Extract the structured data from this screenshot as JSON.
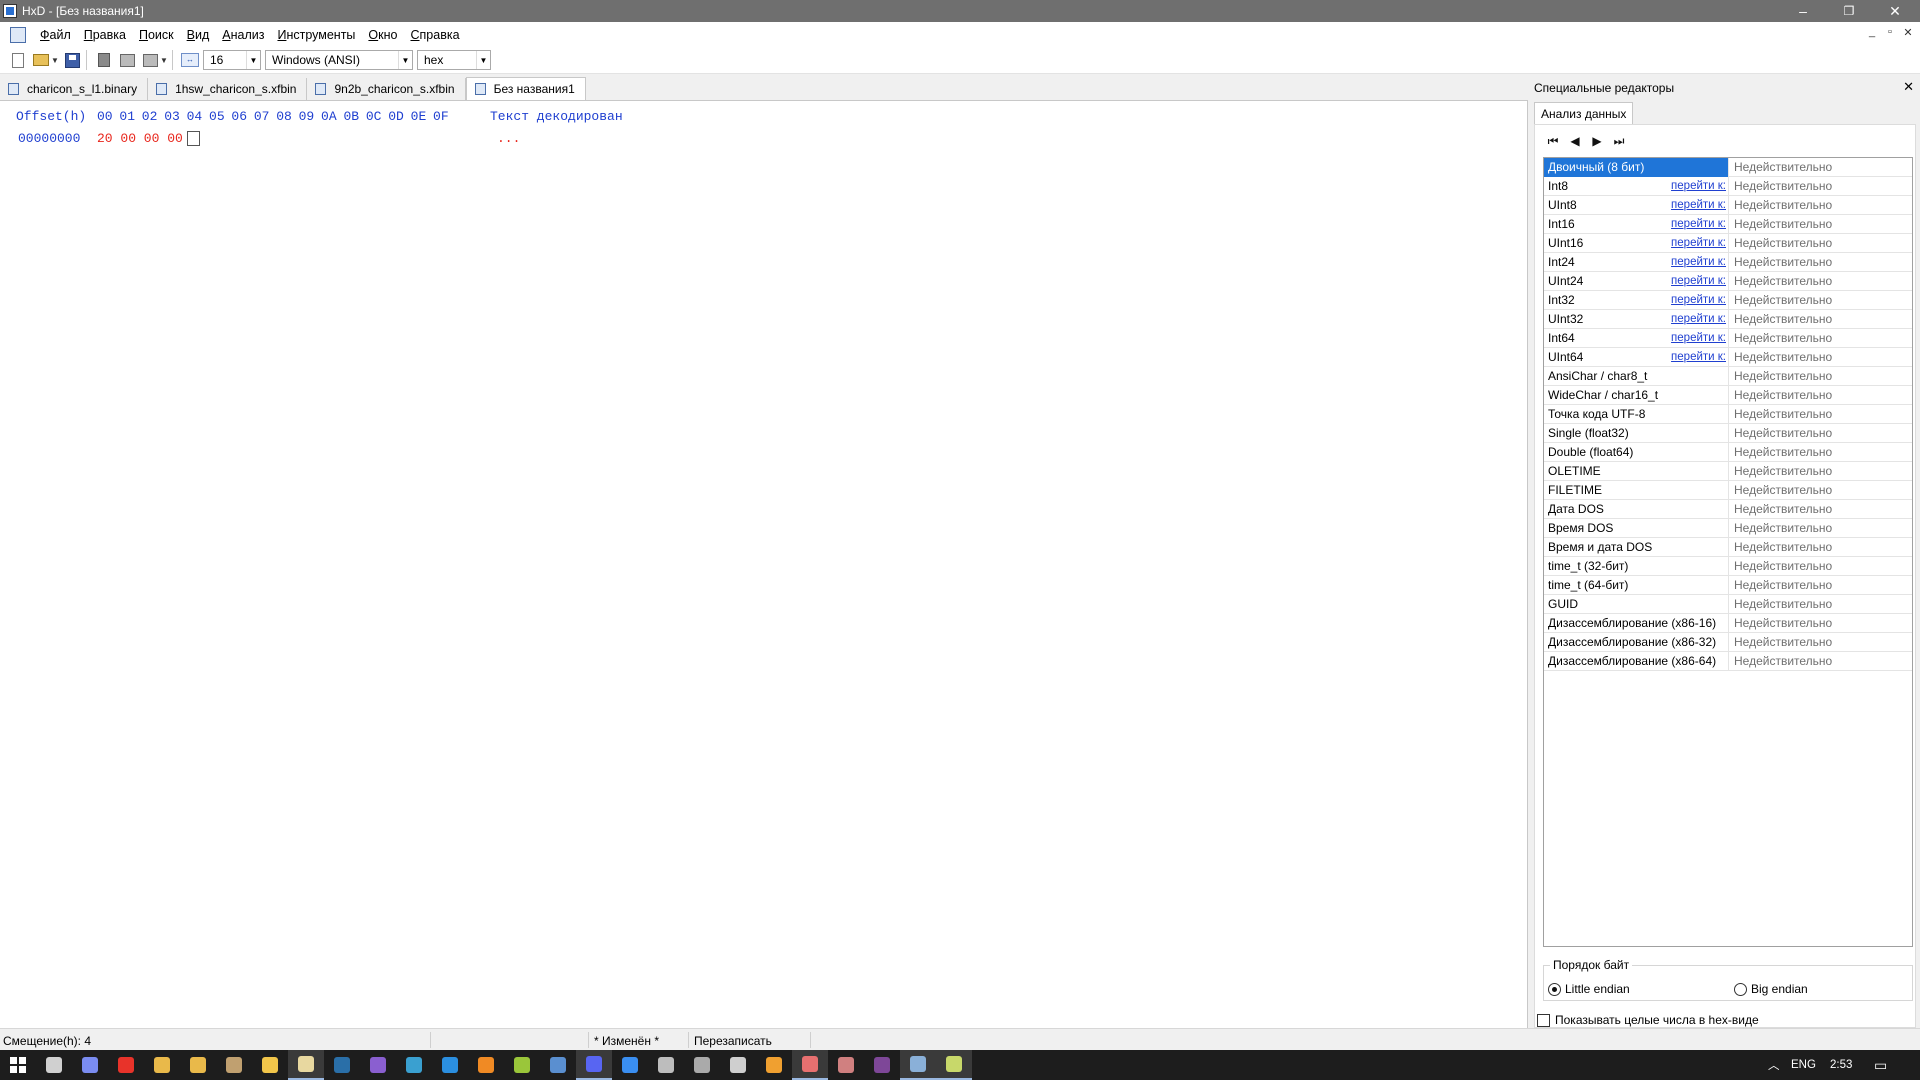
{
  "window": {
    "title": "HxD - [Без названия1]",
    "controls": {
      "minimize": "–",
      "maximize": "❐",
      "close": "✕"
    }
  },
  "menu": [
    "Файл",
    "Правка",
    "Поиск",
    "Вид",
    "Анализ",
    "Инструменты",
    "Окно",
    "Справка"
  ],
  "mdi_controls": {
    "minimize": "_",
    "restore": "▫",
    "close": "✕"
  },
  "toolbar": {
    "bytes_per_row": "16",
    "charset": "Windows (ANSI)",
    "offset_base": "hex"
  },
  "file_tabs": [
    {
      "label": "charicon_s_l1.binary",
      "active": false
    },
    {
      "label": "1hsw_charicon_s.xfbin",
      "active": false
    },
    {
      "label": "9n2b_charicon_s.xfbin",
      "active": false
    },
    {
      "label": "Без названия1",
      "active": true
    }
  ],
  "hex_view": {
    "offset_header": "Offset(h)",
    "column_headers": "00 01 02 03 04 05 06 07 08 09 0A 0B 0C 0D 0E 0F",
    "text_header": "Текст декодирован",
    "rows": [
      {
        "offset": "00000000",
        "bytes": "20 00 00 00",
        "text": "..."
      }
    ]
  },
  "side_panel": {
    "title": "Специальные редакторы",
    "close": "✕",
    "tab": "Анализ данных",
    "nav": {
      "first": "⏮",
      "prev": "◀",
      "next": "▶",
      "last": "⏭"
    },
    "goto_label": "перейти к:",
    "rows": [
      {
        "name": "Двоичный (8 бит)",
        "value": "Недействительно",
        "link": false,
        "selected": true
      },
      {
        "name": "Int8",
        "value": "Недействительно",
        "link": true
      },
      {
        "name": "UInt8",
        "value": "Недействительно",
        "link": true
      },
      {
        "name": "Int16",
        "value": "Недействительно",
        "link": true
      },
      {
        "name": "UInt16",
        "value": "Недействительно",
        "link": true
      },
      {
        "name": "Int24",
        "value": "Недействительно",
        "link": true
      },
      {
        "name": "UInt24",
        "value": "Недействительно",
        "link": true
      },
      {
        "name": "Int32",
        "value": "Недействительно",
        "link": true
      },
      {
        "name": "UInt32",
        "value": "Недействительно",
        "link": true
      },
      {
        "name": "Int64",
        "value": "Недействительно",
        "link": true
      },
      {
        "name": "UInt64",
        "value": "Недействительно",
        "link": true
      },
      {
        "name": "AnsiChar / char8_t",
        "value": "Недействительно",
        "link": false
      },
      {
        "name": "WideChar / char16_t",
        "value": "Недействительно",
        "link": false
      },
      {
        "name": "Точка кода UTF-8",
        "value": "Недействительно",
        "link": false
      },
      {
        "name": "Single (float32)",
        "value": "Недействительно",
        "link": false
      },
      {
        "name": "Double (float64)",
        "value": "Недействительно",
        "link": false
      },
      {
        "name": "OLETIME",
        "value": "Недействительно",
        "link": false
      },
      {
        "name": "FILETIME",
        "value": "Недействительно",
        "link": false
      },
      {
        "name": "Дата DOS",
        "value": "Недействительно",
        "link": false
      },
      {
        "name": "Время DOS",
        "value": "Недействительно",
        "link": false
      },
      {
        "name": "Время и дата DOS",
        "value": "Недействительно",
        "link": false
      },
      {
        "name": "time_t (32-бит)",
        "value": "Недействительно",
        "link": false
      },
      {
        "name": "time_t (64-бит)",
        "value": "Недействительно",
        "link": false
      },
      {
        "name": "GUID",
        "value": "Недействительно",
        "link": false
      },
      {
        "name": "Дизассемблирование (x86-16)",
        "value": "Недействительно",
        "link": false
      },
      {
        "name": "Дизассемблирование (x86-32)",
        "value": "Недействительно",
        "link": false
      },
      {
        "name": "Дизассемблирование (x86-64)",
        "value": "Недействительно",
        "link": false
      }
    ],
    "byte_order": {
      "legend": "Порядок байт",
      "little": "Little endian",
      "big": "Big endian",
      "selected": "little"
    },
    "show_hex_label": "Показывать целые числа в hex-виде"
  },
  "status_bar": {
    "offset": "Смещение(h): 4",
    "modified": "* Изменён *",
    "mode": "Перезаписать"
  },
  "taskbar": {
    "apps": [
      {
        "name": "task-view-icon",
        "color": "#d0d0d0"
      },
      {
        "name": "gamepad-icon",
        "color": "#7a8cf0"
      },
      {
        "name": "yandex-browser-icon",
        "color": "#e8332a"
      },
      {
        "name": "folder-icon",
        "color": "#e9b94a"
      },
      {
        "name": "folder-icon",
        "color": "#e9b94a"
      },
      {
        "name": "game-icon",
        "color": "#c0a070"
      },
      {
        "name": "file-explorer-icon",
        "color": "#f2c64a"
      },
      {
        "name": "hxd-icon",
        "color": "#e8d8a0",
        "active": true
      },
      {
        "name": "steam-icon",
        "color": "#2a6fa8"
      },
      {
        "name": "visual-studio-icon",
        "color": "#8a5fd0"
      },
      {
        "name": "vegas-icon",
        "color": "#3aa0d0"
      },
      {
        "name": "photoshop-icon",
        "color": "#2b8fe0"
      },
      {
        "name": "blender-icon",
        "color": "#f08a24"
      },
      {
        "name": "tennis-ball-icon",
        "color": "#9ac63a"
      },
      {
        "name": "calculator-icon",
        "color": "#5a8fd0"
      },
      {
        "name": "discord-icon",
        "color": "#5865f2",
        "active": true
      },
      {
        "name": "play-icon",
        "color": "#3a8ef0"
      },
      {
        "name": "gear-icon",
        "color": "#bdbdbd"
      },
      {
        "name": "sliders-icon",
        "color": "#aaaaaa"
      },
      {
        "name": "obs-icon",
        "color": "#cfcfcf"
      },
      {
        "name": "orange-icon",
        "color": "#f0a030"
      },
      {
        "name": "paint-icon",
        "color": "#e87070",
        "active": true
      },
      {
        "name": "image-icon",
        "color": "#d08080"
      },
      {
        "name": "tor-icon",
        "color": "#7e4798"
      },
      {
        "name": "picture-icon",
        "color": "#8ab0d8",
        "active": true
      },
      {
        "name": "notepad-icon",
        "color": "#c8d86a",
        "active": true
      }
    ],
    "lang": "ENG",
    "time": "2:53"
  }
}
